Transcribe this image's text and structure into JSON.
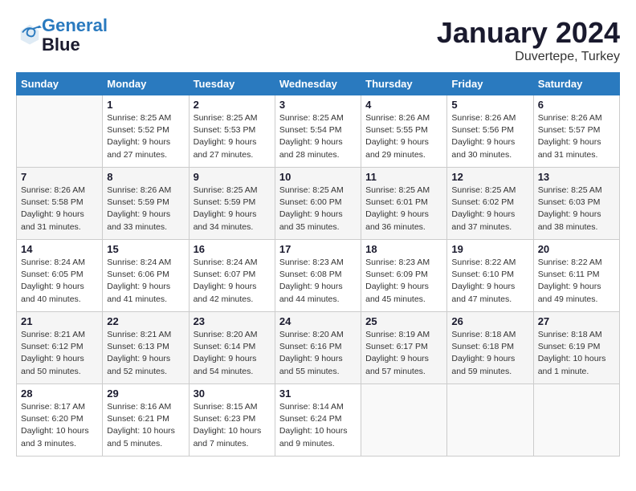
{
  "header": {
    "logo_line1": "General",
    "logo_line2": "Blue",
    "month_title": "January 2024",
    "location": "Duvertepe, Turkey"
  },
  "days_of_week": [
    "Sunday",
    "Monday",
    "Tuesday",
    "Wednesday",
    "Thursday",
    "Friday",
    "Saturday"
  ],
  "weeks": [
    [
      {
        "day": "",
        "sunrise": "",
        "sunset": "",
        "daylight": ""
      },
      {
        "day": "1",
        "sunrise": "Sunrise: 8:25 AM",
        "sunset": "Sunset: 5:52 PM",
        "daylight": "Daylight: 9 hours and 27 minutes."
      },
      {
        "day": "2",
        "sunrise": "Sunrise: 8:25 AM",
        "sunset": "Sunset: 5:53 PM",
        "daylight": "Daylight: 9 hours and 27 minutes."
      },
      {
        "day": "3",
        "sunrise": "Sunrise: 8:25 AM",
        "sunset": "Sunset: 5:54 PM",
        "daylight": "Daylight: 9 hours and 28 minutes."
      },
      {
        "day": "4",
        "sunrise": "Sunrise: 8:26 AM",
        "sunset": "Sunset: 5:55 PM",
        "daylight": "Daylight: 9 hours and 29 minutes."
      },
      {
        "day": "5",
        "sunrise": "Sunrise: 8:26 AM",
        "sunset": "Sunset: 5:56 PM",
        "daylight": "Daylight: 9 hours and 30 minutes."
      },
      {
        "day": "6",
        "sunrise": "Sunrise: 8:26 AM",
        "sunset": "Sunset: 5:57 PM",
        "daylight": "Daylight: 9 hours and 31 minutes."
      }
    ],
    [
      {
        "day": "7",
        "sunrise": "Sunrise: 8:26 AM",
        "sunset": "Sunset: 5:58 PM",
        "daylight": "Daylight: 9 hours and 31 minutes."
      },
      {
        "day": "8",
        "sunrise": "Sunrise: 8:26 AM",
        "sunset": "Sunset: 5:59 PM",
        "daylight": "Daylight: 9 hours and 33 minutes."
      },
      {
        "day": "9",
        "sunrise": "Sunrise: 8:25 AM",
        "sunset": "Sunset: 5:59 PM",
        "daylight": "Daylight: 9 hours and 34 minutes."
      },
      {
        "day": "10",
        "sunrise": "Sunrise: 8:25 AM",
        "sunset": "Sunset: 6:00 PM",
        "daylight": "Daylight: 9 hours and 35 minutes."
      },
      {
        "day": "11",
        "sunrise": "Sunrise: 8:25 AM",
        "sunset": "Sunset: 6:01 PM",
        "daylight": "Daylight: 9 hours and 36 minutes."
      },
      {
        "day": "12",
        "sunrise": "Sunrise: 8:25 AM",
        "sunset": "Sunset: 6:02 PM",
        "daylight": "Daylight: 9 hours and 37 minutes."
      },
      {
        "day": "13",
        "sunrise": "Sunrise: 8:25 AM",
        "sunset": "Sunset: 6:03 PM",
        "daylight": "Daylight: 9 hours and 38 minutes."
      }
    ],
    [
      {
        "day": "14",
        "sunrise": "Sunrise: 8:24 AM",
        "sunset": "Sunset: 6:05 PM",
        "daylight": "Daylight: 9 hours and 40 minutes."
      },
      {
        "day": "15",
        "sunrise": "Sunrise: 8:24 AM",
        "sunset": "Sunset: 6:06 PM",
        "daylight": "Daylight: 9 hours and 41 minutes."
      },
      {
        "day": "16",
        "sunrise": "Sunrise: 8:24 AM",
        "sunset": "Sunset: 6:07 PM",
        "daylight": "Daylight: 9 hours and 42 minutes."
      },
      {
        "day": "17",
        "sunrise": "Sunrise: 8:23 AM",
        "sunset": "Sunset: 6:08 PM",
        "daylight": "Daylight: 9 hours and 44 minutes."
      },
      {
        "day": "18",
        "sunrise": "Sunrise: 8:23 AM",
        "sunset": "Sunset: 6:09 PM",
        "daylight": "Daylight: 9 hours and 45 minutes."
      },
      {
        "day": "19",
        "sunrise": "Sunrise: 8:22 AM",
        "sunset": "Sunset: 6:10 PM",
        "daylight": "Daylight: 9 hours and 47 minutes."
      },
      {
        "day": "20",
        "sunrise": "Sunrise: 8:22 AM",
        "sunset": "Sunset: 6:11 PM",
        "daylight": "Daylight: 9 hours and 49 minutes."
      }
    ],
    [
      {
        "day": "21",
        "sunrise": "Sunrise: 8:21 AM",
        "sunset": "Sunset: 6:12 PM",
        "daylight": "Daylight: 9 hours and 50 minutes."
      },
      {
        "day": "22",
        "sunrise": "Sunrise: 8:21 AM",
        "sunset": "Sunset: 6:13 PM",
        "daylight": "Daylight: 9 hours and 52 minutes."
      },
      {
        "day": "23",
        "sunrise": "Sunrise: 8:20 AM",
        "sunset": "Sunset: 6:14 PM",
        "daylight": "Daylight: 9 hours and 54 minutes."
      },
      {
        "day": "24",
        "sunrise": "Sunrise: 8:20 AM",
        "sunset": "Sunset: 6:16 PM",
        "daylight": "Daylight: 9 hours and 55 minutes."
      },
      {
        "day": "25",
        "sunrise": "Sunrise: 8:19 AM",
        "sunset": "Sunset: 6:17 PM",
        "daylight": "Daylight: 9 hours and 57 minutes."
      },
      {
        "day": "26",
        "sunrise": "Sunrise: 8:18 AM",
        "sunset": "Sunset: 6:18 PM",
        "daylight": "Daylight: 9 hours and 59 minutes."
      },
      {
        "day": "27",
        "sunrise": "Sunrise: 8:18 AM",
        "sunset": "Sunset: 6:19 PM",
        "daylight": "Daylight: 10 hours and 1 minute."
      }
    ],
    [
      {
        "day": "28",
        "sunrise": "Sunrise: 8:17 AM",
        "sunset": "Sunset: 6:20 PM",
        "daylight": "Daylight: 10 hours and 3 minutes."
      },
      {
        "day": "29",
        "sunrise": "Sunrise: 8:16 AM",
        "sunset": "Sunset: 6:21 PM",
        "daylight": "Daylight: 10 hours and 5 minutes."
      },
      {
        "day": "30",
        "sunrise": "Sunrise: 8:15 AM",
        "sunset": "Sunset: 6:23 PM",
        "daylight": "Daylight: 10 hours and 7 minutes."
      },
      {
        "day": "31",
        "sunrise": "Sunrise: 8:14 AM",
        "sunset": "Sunset: 6:24 PM",
        "daylight": "Daylight: 10 hours and 9 minutes."
      },
      {
        "day": "",
        "sunrise": "",
        "sunset": "",
        "daylight": ""
      },
      {
        "day": "",
        "sunrise": "",
        "sunset": "",
        "daylight": ""
      },
      {
        "day": "",
        "sunrise": "",
        "sunset": "",
        "daylight": ""
      }
    ]
  ]
}
